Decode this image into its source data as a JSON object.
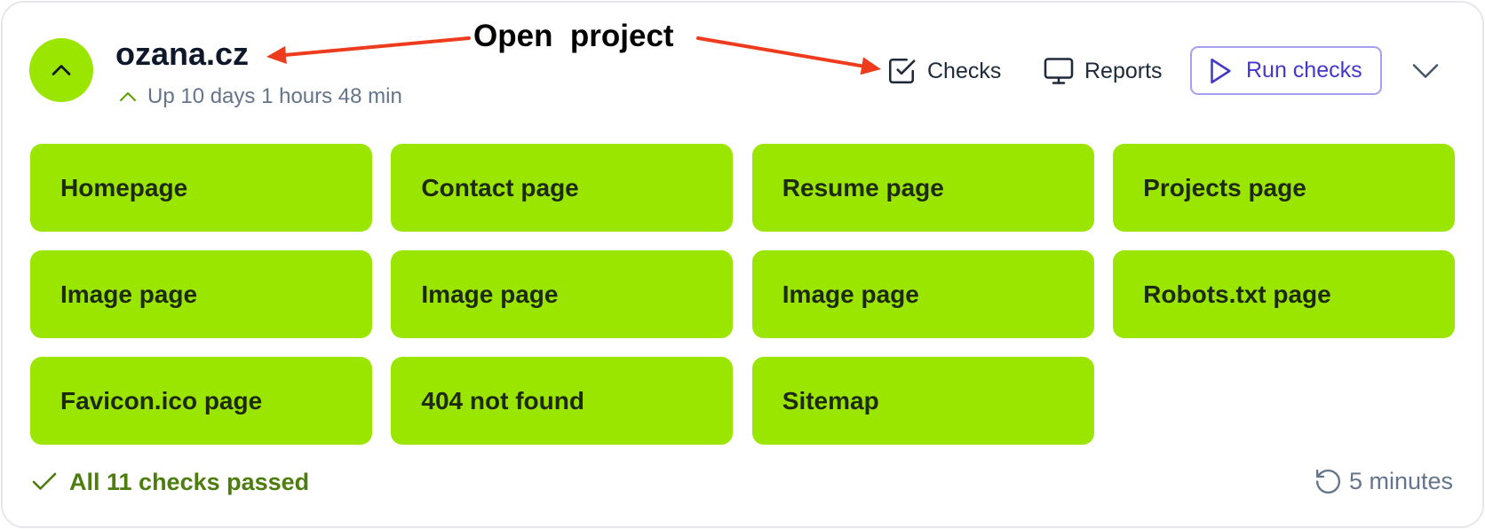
{
  "annotation": {
    "label": "Open  project"
  },
  "project": {
    "name": "ozana.cz",
    "uptime": "Up 10 days 1 hours 48 min",
    "collapse_icon": "chevron-up-icon",
    "uptime_icon": "chevron-up-icon"
  },
  "actions": {
    "checks": {
      "label": "Checks",
      "icon": "check-square-icon"
    },
    "reports": {
      "label": "Reports",
      "icon": "monitor-icon"
    },
    "run": {
      "label": "Run checks",
      "icon": "play-icon"
    },
    "expand_icon": "chevron-down-icon"
  },
  "tiles": [
    {
      "label": "Homepage"
    },
    {
      "label": "Contact page"
    },
    {
      "label": "Resume page"
    },
    {
      "label": "Projects page"
    },
    {
      "label": "Image page"
    },
    {
      "label": "Image page"
    },
    {
      "label": "Image page"
    },
    {
      "label": "Robots.txt page"
    },
    {
      "label": "Favicon.ico page"
    },
    {
      "label": "404 not found"
    },
    {
      "label": "Sitemap"
    }
  ],
  "footer": {
    "status": "All 11 checks passed",
    "status_icon": "check-icon",
    "interval": "5 minutes",
    "interval_icon": "refresh-icon"
  },
  "colors": {
    "tile_passed": "#9be600",
    "toggle_bg": "#9be600",
    "uptime_accent": "#65a30d",
    "run_accent": "#4338ca",
    "run_border": "#a5a0f2",
    "passed_text": "#4d7c0f",
    "annotation_arrow": "#ef3b1d"
  }
}
